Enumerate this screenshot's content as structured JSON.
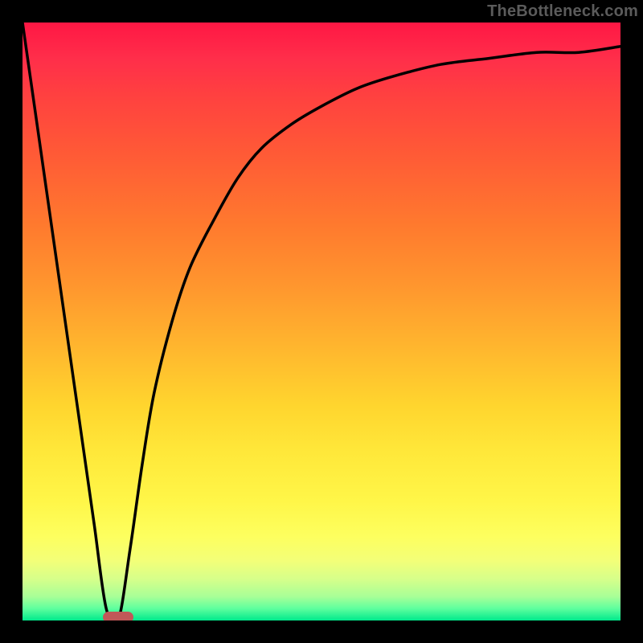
{
  "watermark": "TheBottleneck.com",
  "chart_data": {
    "type": "line",
    "x": [
      0.0,
      0.02,
      0.04,
      0.06,
      0.08,
      0.1,
      0.12,
      0.14,
      0.16,
      0.18,
      0.2,
      0.22,
      0.25,
      0.28,
      0.32,
      0.36,
      0.4,
      0.45,
      0.5,
      0.56,
      0.62,
      0.7,
      0.78,
      0.86,
      0.93,
      1.0
    ],
    "y": [
      1.0,
      0.86,
      0.72,
      0.58,
      0.44,
      0.3,
      0.16,
      0.02,
      0.0,
      0.12,
      0.26,
      0.38,
      0.5,
      0.59,
      0.67,
      0.74,
      0.79,
      0.83,
      0.86,
      0.89,
      0.91,
      0.93,
      0.94,
      0.95,
      0.95,
      0.96
    ],
    "xlim": [
      0,
      1
    ],
    "ylim": [
      0,
      1
    ],
    "title": "",
    "xlabel": "",
    "ylabel": "",
    "marker": {
      "x": 0.16,
      "y": 0.0
    },
    "colors": {
      "curve": "#000000",
      "marker": "#c15858",
      "gradient_top": "#ff1744",
      "gradient_bottom": "#00e98c"
    }
  }
}
